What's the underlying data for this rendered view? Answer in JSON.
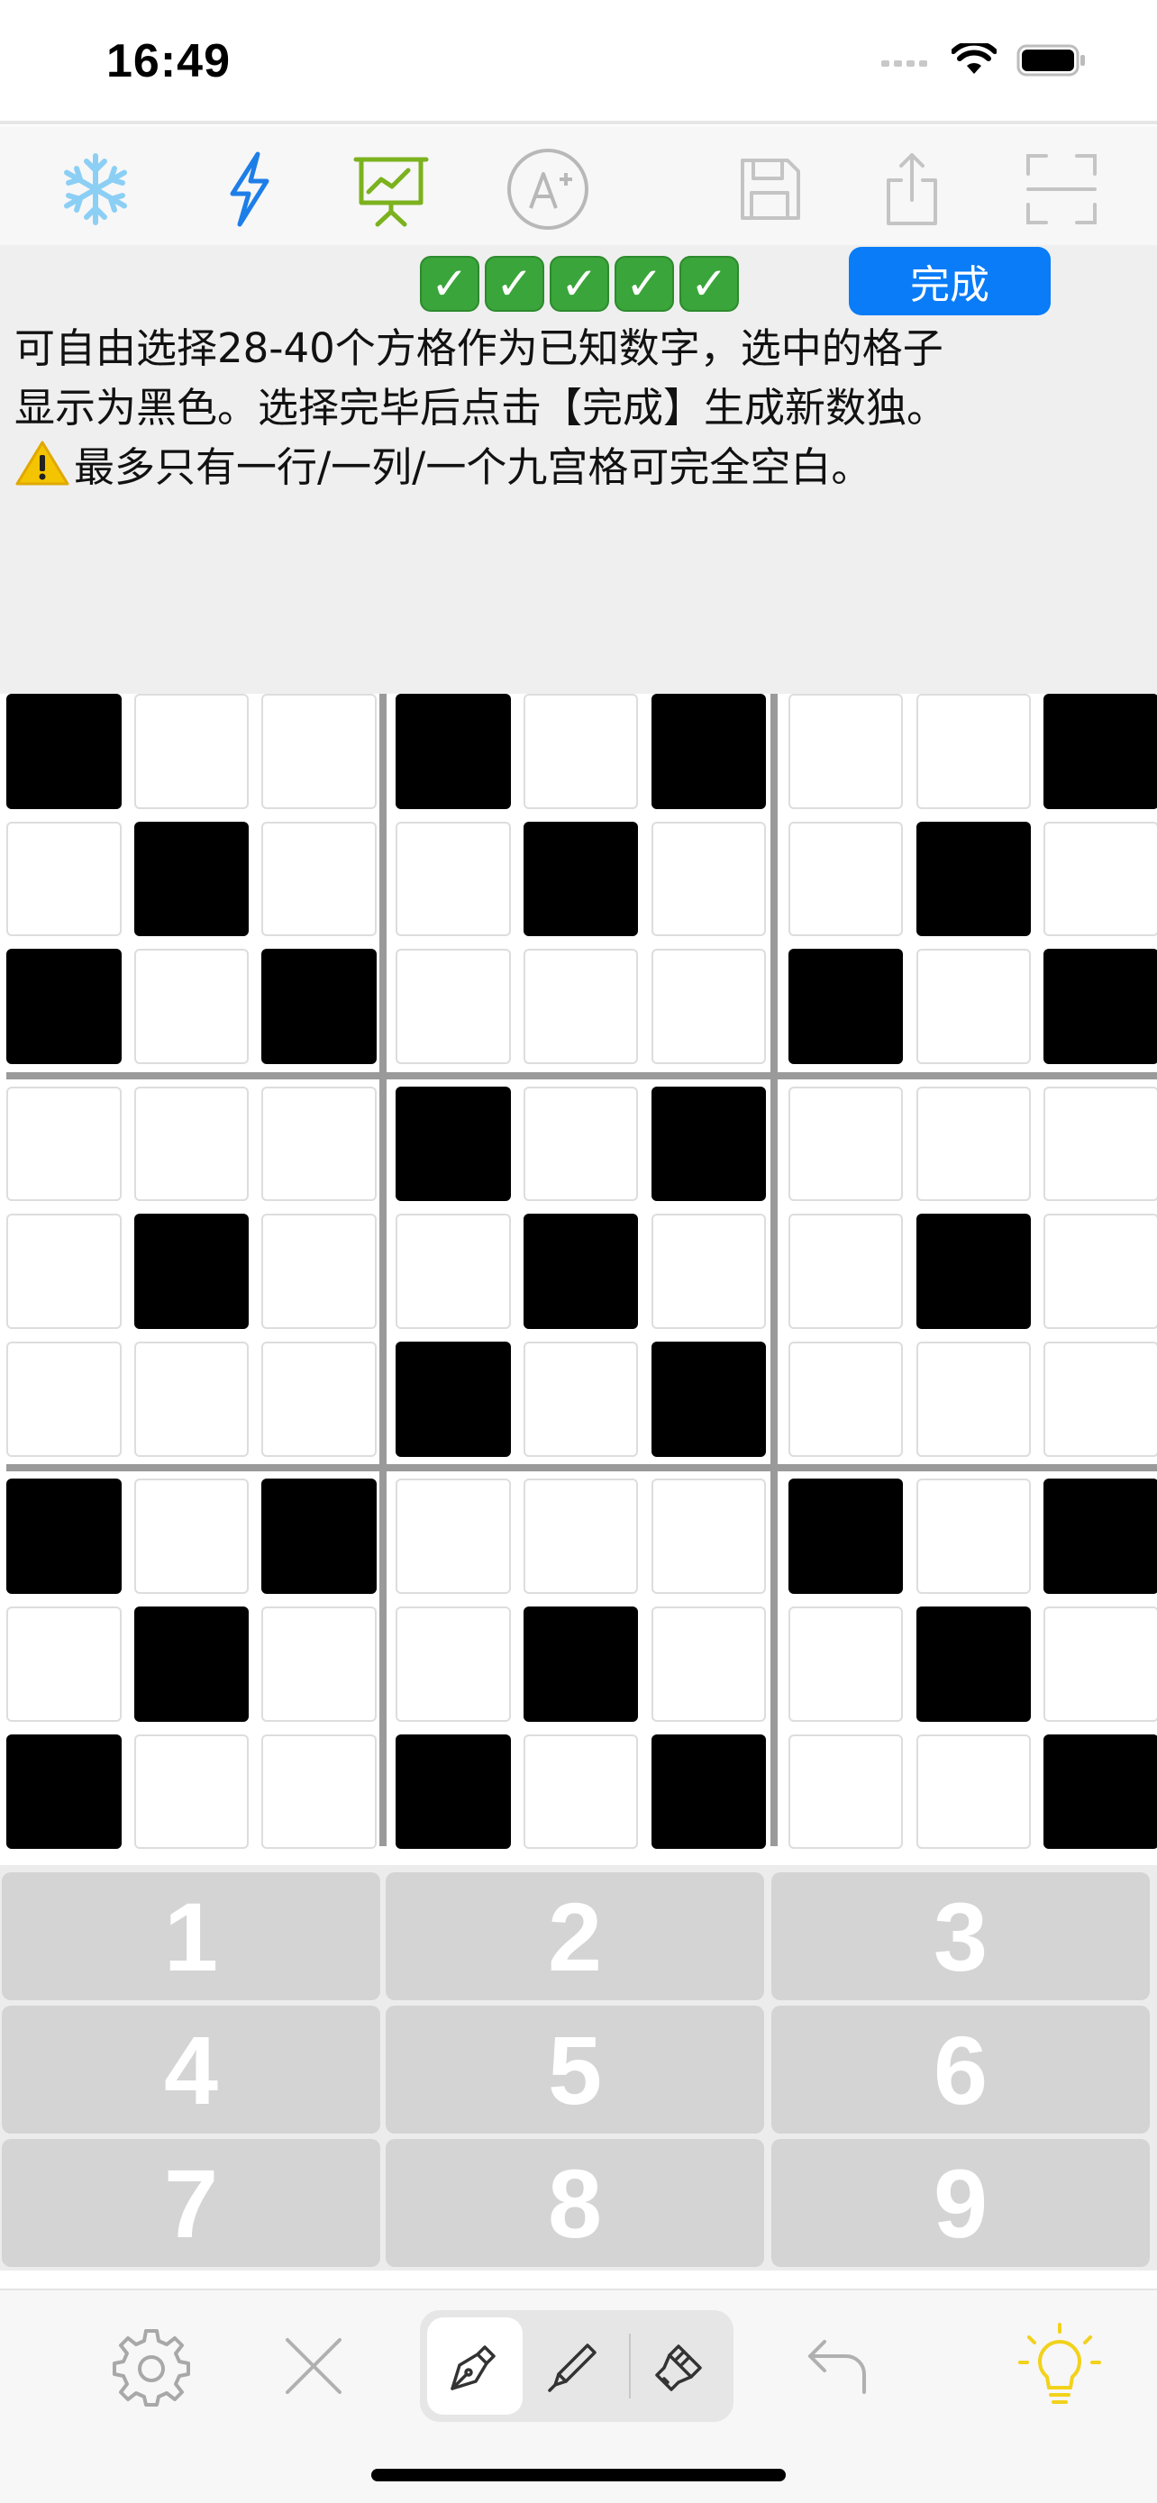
{
  "status_bar": {
    "time": "16:49"
  },
  "toolbar": {
    "icons": [
      "snowflake-icon",
      "lightning-icon",
      "presentation-chart-icon",
      "grade-a-plus-icon",
      "save-icon",
      "share-icon",
      "fullscreen-icon"
    ]
  },
  "progress": {
    "check_count": 5,
    "check_symbol": "✓"
  },
  "done_button": {
    "label": "完成"
  },
  "instructions": {
    "line1": "可自由选择28-40个方格作为已知数字，选中的格子",
    "line2": "显示为黑色。选择完毕后点击【完成】生成新数独。",
    "line3": "最多只有一行/一列/一个九宫格可完全空白。"
  },
  "grid": {
    "rows": [
      [
        1,
        0,
        0,
        1,
        0,
        1,
        0,
        0,
        1
      ],
      [
        0,
        1,
        0,
        0,
        1,
        0,
        0,
        1,
        0
      ],
      [
        1,
        0,
        1,
        0,
        0,
        0,
        1,
        0,
        1
      ],
      [
        0,
        0,
        0,
        1,
        0,
        1,
        0,
        0,
        0
      ],
      [
        0,
        1,
        0,
        0,
        1,
        0,
        0,
        1,
        0
      ],
      [
        0,
        0,
        0,
        1,
        0,
        1,
        0,
        0,
        0
      ],
      [
        1,
        0,
        1,
        0,
        0,
        0,
        1,
        0,
        1
      ],
      [
        0,
        1,
        0,
        0,
        1,
        0,
        0,
        1,
        0
      ],
      [
        1,
        0,
        0,
        1,
        0,
        1,
        0,
        0,
        1
      ]
    ]
  },
  "keypad": {
    "keys": [
      "1",
      "2",
      "3",
      "4",
      "5",
      "6",
      "7",
      "8",
      "9"
    ]
  },
  "bottom_bar": {
    "icons": [
      "settings-icon",
      "clear-icon",
      "pen-icon",
      "pencil-icon",
      "brush-icon",
      "undo-icon",
      "hint-bulb-icon"
    ],
    "selected_mode": "pen"
  },
  "colors": {
    "accent": "#0a7cf7",
    "check_green": "#3aa53a",
    "bulb_yellow": "#f2d21b"
  }
}
